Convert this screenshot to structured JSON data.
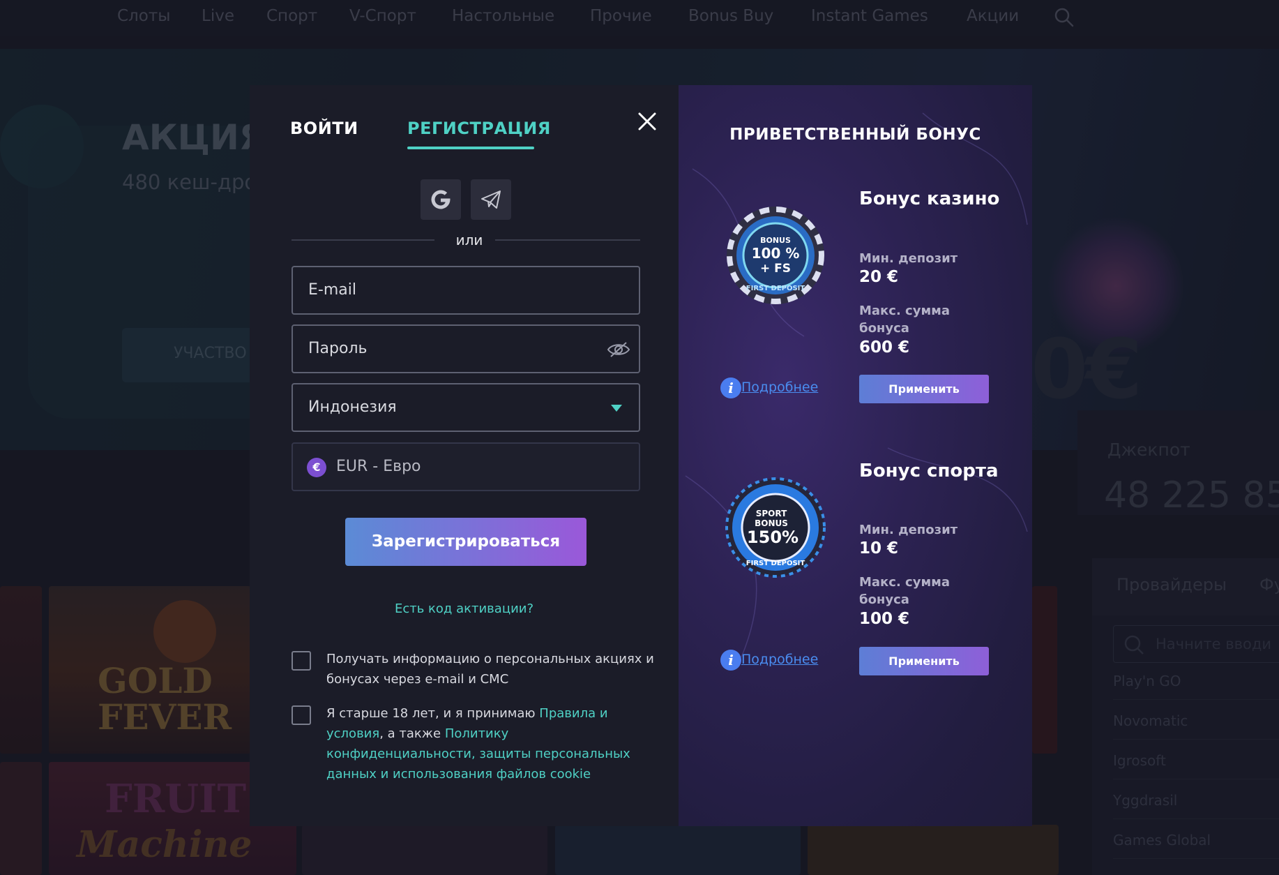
{
  "nav": {
    "items": [
      "Слоты",
      "Live",
      "Спорт",
      "V-Спорт",
      "Настольные",
      "Прочие",
      "Bonus Buy",
      "Instant Games",
      "Акции"
    ]
  },
  "hero": {
    "title": "АКЦИЯ",
    "subtitle": "480 кеш-дро",
    "button": "УЧАСТВО",
    "amount": "0€"
  },
  "jackpot": {
    "label": "Джекпот",
    "value": "48 225 85"
  },
  "providers": {
    "tabs": [
      "Провайдеры",
      "Фу"
    ],
    "search_placeholder": "Начните вводи",
    "items": [
      "Play'n GO",
      "Novomatic",
      "Igrosoft",
      "Yggdrasil",
      "Games Global"
    ]
  },
  "tiles": {
    "gold_fever": "GOLD\nFEVER",
    "fruit_machine": "FRUIT",
    "fruit_machine_2": "Machine"
  },
  "modal": {
    "tab_login": "ВОЙТИ",
    "tab_register": "РЕГИСТРАЦИЯ",
    "divider": "или",
    "email_placeholder": "E-mail",
    "password_placeholder": "Пароль",
    "country": "Индонезия",
    "currency": "EUR - Евро",
    "currency_symbol": "€",
    "register_button": "Зарегистрироваться",
    "activation_link": "Есть код активации?",
    "checkbox1_text": "Получать информацию о персональных акциях и бонусах через e-mail и СМС",
    "checkbox2_prefix": "Я старше 18 лет, и я принимаю ",
    "checkbox2_link1": "Правила и условия",
    "checkbox2_mid": ", а также ",
    "checkbox2_link2": "Политику конфиденциальности, защиты персональных данных и использования файлов cookie"
  },
  "promo": {
    "title": "ПРИВЕТСТВЕННЫЙ БОНУС",
    "bonuses": [
      {
        "title": "Бонус казино",
        "min_label": "Мин. депозит",
        "min_value": "20 €",
        "max_label": "Макс. сумма бонуса",
        "max_value": "600 €",
        "more": "Подробнее",
        "apply": "Применить",
        "chip_line1": "BONUS",
        "chip_line2": "100 %",
        "chip_line3": "+ FS",
        "chip_ring": "FIRST DEPOSIT"
      },
      {
        "title": "Бонус спорта",
        "min_label": "Мин. депозит",
        "min_value": "10 €",
        "max_label": "Макс. сумма бонуса",
        "max_value": "100 €",
        "more": "Подробнее",
        "apply": "Применить",
        "chip_line1": "SPORT",
        "chip_line2": "BONUS",
        "chip_line3": "150%",
        "chip_ring": "FIRST DEPOSIT"
      }
    ]
  },
  "colors": {
    "accent": "#4fd1c5",
    "link_blue": "#4a8df0",
    "button_gradient_start": "#5b8bd6",
    "button_gradient_end": "#9a58d9"
  }
}
